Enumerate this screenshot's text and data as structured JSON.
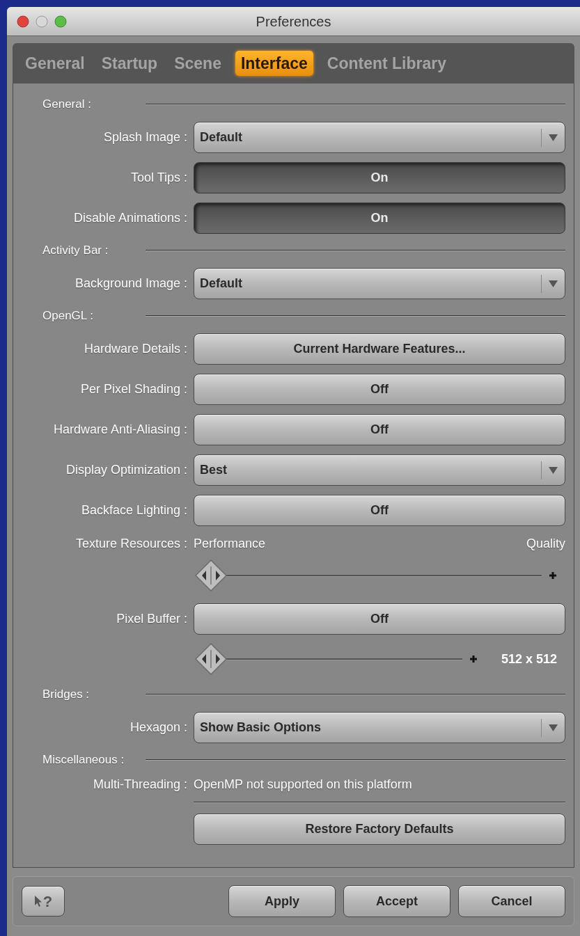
{
  "window": {
    "title": "Preferences"
  },
  "tabs": [
    {
      "label": "General",
      "selected": false
    },
    {
      "label": "Startup",
      "selected": false
    },
    {
      "label": "Scene",
      "selected": false
    },
    {
      "label": "Interface",
      "selected": true
    },
    {
      "label": "Content Library",
      "selected": false
    }
  ],
  "rows": [
    {
      "kind": "section",
      "label": "General :"
    },
    {
      "kind": "dropdown",
      "label": "Splash Image :",
      "value": "Default"
    },
    {
      "kind": "toggle",
      "label": "Tool Tips :",
      "value": "On",
      "on": true
    },
    {
      "kind": "toggle",
      "label": "Disable Animations :",
      "value": "On",
      "on": true
    },
    {
      "kind": "section",
      "label": "Activity Bar :"
    },
    {
      "kind": "dropdown",
      "label": "Background Image :",
      "value": "Default"
    },
    {
      "kind": "section",
      "label": "OpenGL :"
    },
    {
      "kind": "button",
      "label": "Hardware Details :",
      "value": "Current Hardware Features..."
    },
    {
      "kind": "toggle",
      "label": "Per Pixel Shading :",
      "value": "Off",
      "on": false
    },
    {
      "kind": "toggle",
      "label": "Hardware Anti-Aliasing :",
      "value": "Off",
      "on": false
    },
    {
      "kind": "dropdown",
      "label": "Display Optimization :",
      "value": "Best"
    },
    {
      "kind": "toggle",
      "label": "Backface Lighting :",
      "value": "Off",
      "on": false
    },
    {
      "kind": "range_labels",
      "label": "Texture Resources :",
      "min_label": "Performance",
      "max_label": "Quality"
    },
    {
      "kind": "slider",
      "level": 0
    },
    {
      "kind": "toggle",
      "label": "Pixel Buffer :",
      "value": "Off",
      "on": false
    },
    {
      "kind": "slider",
      "level": 0,
      "reading": "512 x 512"
    },
    {
      "kind": "section",
      "label": "Bridges :"
    },
    {
      "kind": "dropdown",
      "label": "Hexagon :",
      "value": "Show Basic Options"
    },
    {
      "kind": "section",
      "label": "Miscellaneous :"
    },
    {
      "kind": "info",
      "label": "Multi-Threading :",
      "value": "OpenMP not supported on this platform"
    },
    {
      "kind": "divider"
    },
    {
      "kind": "button",
      "value": "Restore Factory Defaults"
    }
  ],
  "help_button": {
    "label": "?"
  },
  "buttons": [
    "Apply",
    "Accept",
    "Cancel"
  ]
}
